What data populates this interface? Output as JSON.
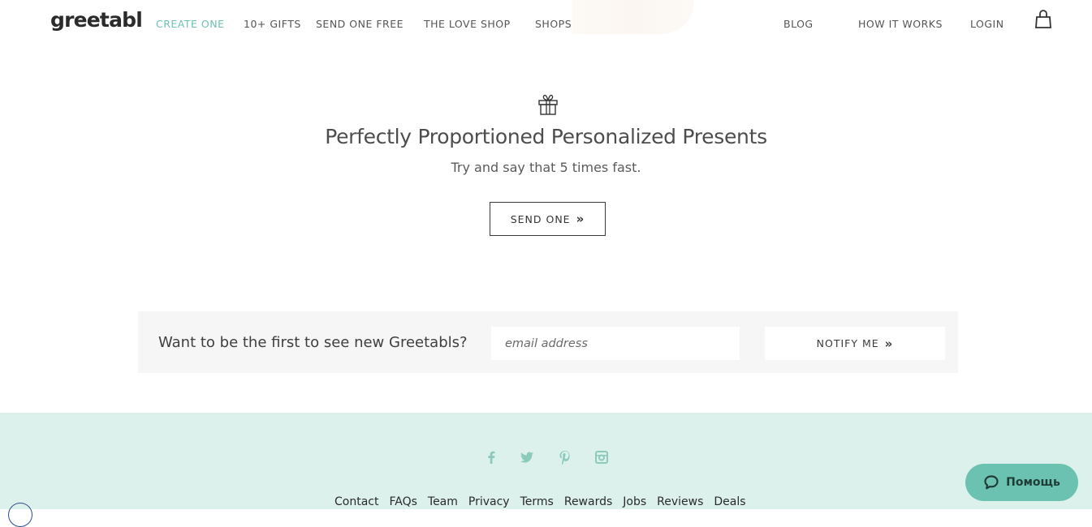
{
  "brand": {
    "logo": "greetabl"
  },
  "nav": {
    "items": [
      {
        "label": "CREATE ONE"
      },
      {
        "label": "10+ GIFTS"
      },
      {
        "label": "SEND ONE FREE"
      },
      {
        "label": "THE LOVE SHOP"
      },
      {
        "label": "SHOPS"
      }
    ],
    "right": [
      {
        "label": "BLOG"
      },
      {
        "label": "HOW IT WORKS"
      },
      {
        "label": "LOGIN"
      }
    ],
    "cart_icon": "shopping-bag-icon",
    "accent_color": "#6cc2b3"
  },
  "hero": {
    "icon": "gift-icon",
    "headline": "Perfectly Proportioned Personalized Presents",
    "subline": "Try and say that 5 times fast.",
    "button_label": "SEND ONE",
    "button_arrow": "»"
  },
  "notify": {
    "prompt": "Want to be the first to see new Greetabls?",
    "email_placeholder": "email address",
    "button_label": "NOTIFY ME",
    "button_arrow": "»"
  },
  "footer": {
    "background_color": "#dcf1ec",
    "social_icons": [
      "facebook-icon",
      "twitter-icon",
      "pinterest-icon",
      "instagram-icon"
    ],
    "links": [
      "Contact",
      "FAQs",
      "Team",
      "Privacy",
      "Terms",
      "Rewards",
      "Jobs",
      "Reviews",
      "Deals"
    ]
  },
  "help_widget": {
    "label": "Помощь",
    "icon": "chat-bubble-icon",
    "color": "#6cc2b0"
  }
}
